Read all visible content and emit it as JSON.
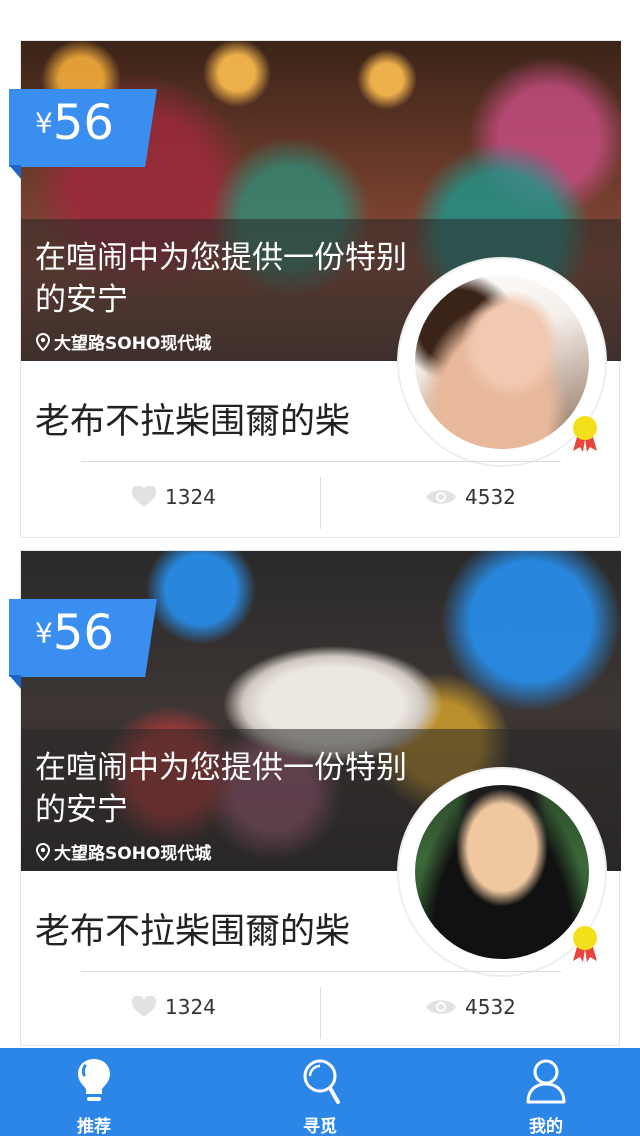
{
  "cards": [
    {
      "price": {
        "currency": "¥",
        "amount": "56"
      },
      "caption": {
        "title": "在喧闹中为您提供一份特别的安宁",
        "location": "大望路SOHO现代城"
      },
      "dish_name": "老布不拉柴围爾的柴",
      "likes": "1324",
      "views": "4532",
      "photo": "cafe-terrace",
      "avatar": "woman-portrait"
    },
    {
      "price": {
        "currency": "¥",
        "amount": "56"
      },
      "caption": {
        "title": "在喧闹中为您提供一份特别的安宁",
        "location": "大望路SOHO现代城"
      },
      "dish_name": "老布不拉柴围爾的柴",
      "likes": "1324",
      "views": "4532",
      "photo": "dessert-plate",
      "avatar": "chef-portrait"
    }
  ],
  "tabbar": {
    "tabs": [
      {
        "label": "推荐",
        "icon": "lightbulb-icon",
        "selected": true
      },
      {
        "label": "寻觅",
        "icon": "search-icon",
        "selected": false
      },
      {
        "label": "我的",
        "icon": "user-icon",
        "selected": false
      }
    ]
  },
  "colors": {
    "accent": "#3a8ef0",
    "tabbar": "#2b86e8",
    "medal": "#f2e11a"
  }
}
